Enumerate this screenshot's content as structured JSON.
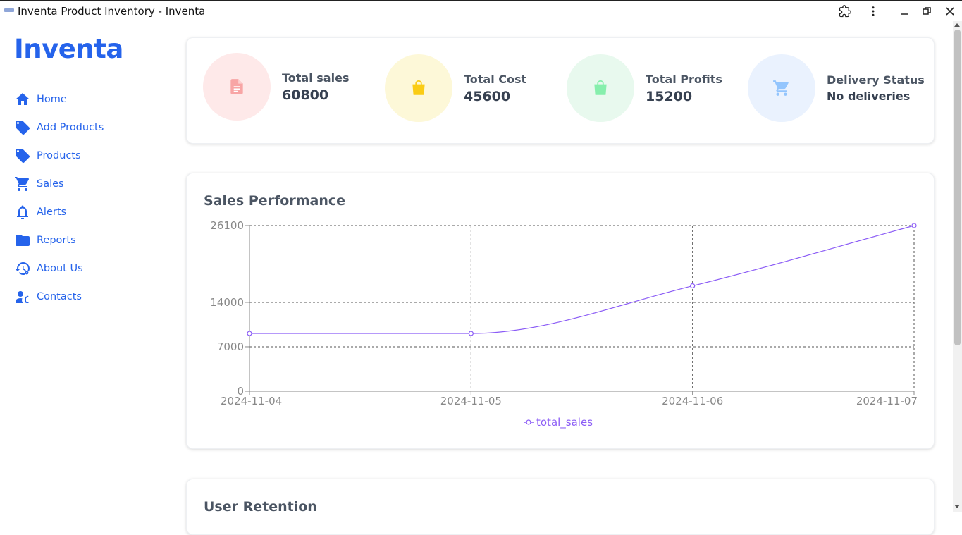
{
  "window": {
    "title": "Inventa Product Inventory - Inventa"
  },
  "sidebar": {
    "brand": "Inventa",
    "items": [
      {
        "label": "Home",
        "icon": "home-icon"
      },
      {
        "label": "Add Products",
        "icon": "tag-icon"
      },
      {
        "label": "Products",
        "icon": "tag-icon"
      },
      {
        "label": "Sales",
        "icon": "cart-icon"
      },
      {
        "label": "Alerts",
        "icon": "bell-icon"
      },
      {
        "label": "Reports",
        "icon": "folder-icon"
      },
      {
        "label": "About Us",
        "icon": "history-gear-icon"
      },
      {
        "label": "Contacts",
        "icon": "contacts-icon"
      }
    ],
    "accent_color": "#2563eb"
  },
  "stats": [
    {
      "label": "Total sales",
      "value": "60800",
      "icon": "document-icon",
      "circle_color": "#fee9e9",
      "icon_color": "#f8a5a5"
    },
    {
      "label": "Total Cost",
      "value": "45600",
      "icon": "shopping-bag-icon",
      "circle_color": "#fdf8d8",
      "icon_color": "#facc15"
    },
    {
      "label": "Total Profits",
      "value": "15200",
      "icon": "shopping-bag-icon",
      "circle_color": "#e8f9ee",
      "icon_color": "#86efac"
    },
    {
      "label": "Delivery Status",
      "value": "No deliveries",
      "icon": "cart-icon",
      "circle_color": "#eaf2fe",
      "icon_color": "#93c5fd"
    }
  ],
  "sales_card": {
    "title": "Sales Performance"
  },
  "retention_card": {
    "title": "User Retention"
  },
  "chart_data": {
    "type": "line",
    "title": "Sales Performance",
    "x": [
      "2024-11-04",
      "2024-11-05",
      "2024-11-06",
      "2024-11-07"
    ],
    "series": [
      {
        "name": "total_sales",
        "values": [
          9100,
          9100,
          16600,
          26100
        ],
        "color": "#8b5cf6"
      }
    ],
    "y_ticks": [
      "0",
      "7000",
      "14000",
      "26100"
    ],
    "ylim": [
      0,
      26100
    ],
    "grid": true,
    "legend_position": "bottom"
  }
}
